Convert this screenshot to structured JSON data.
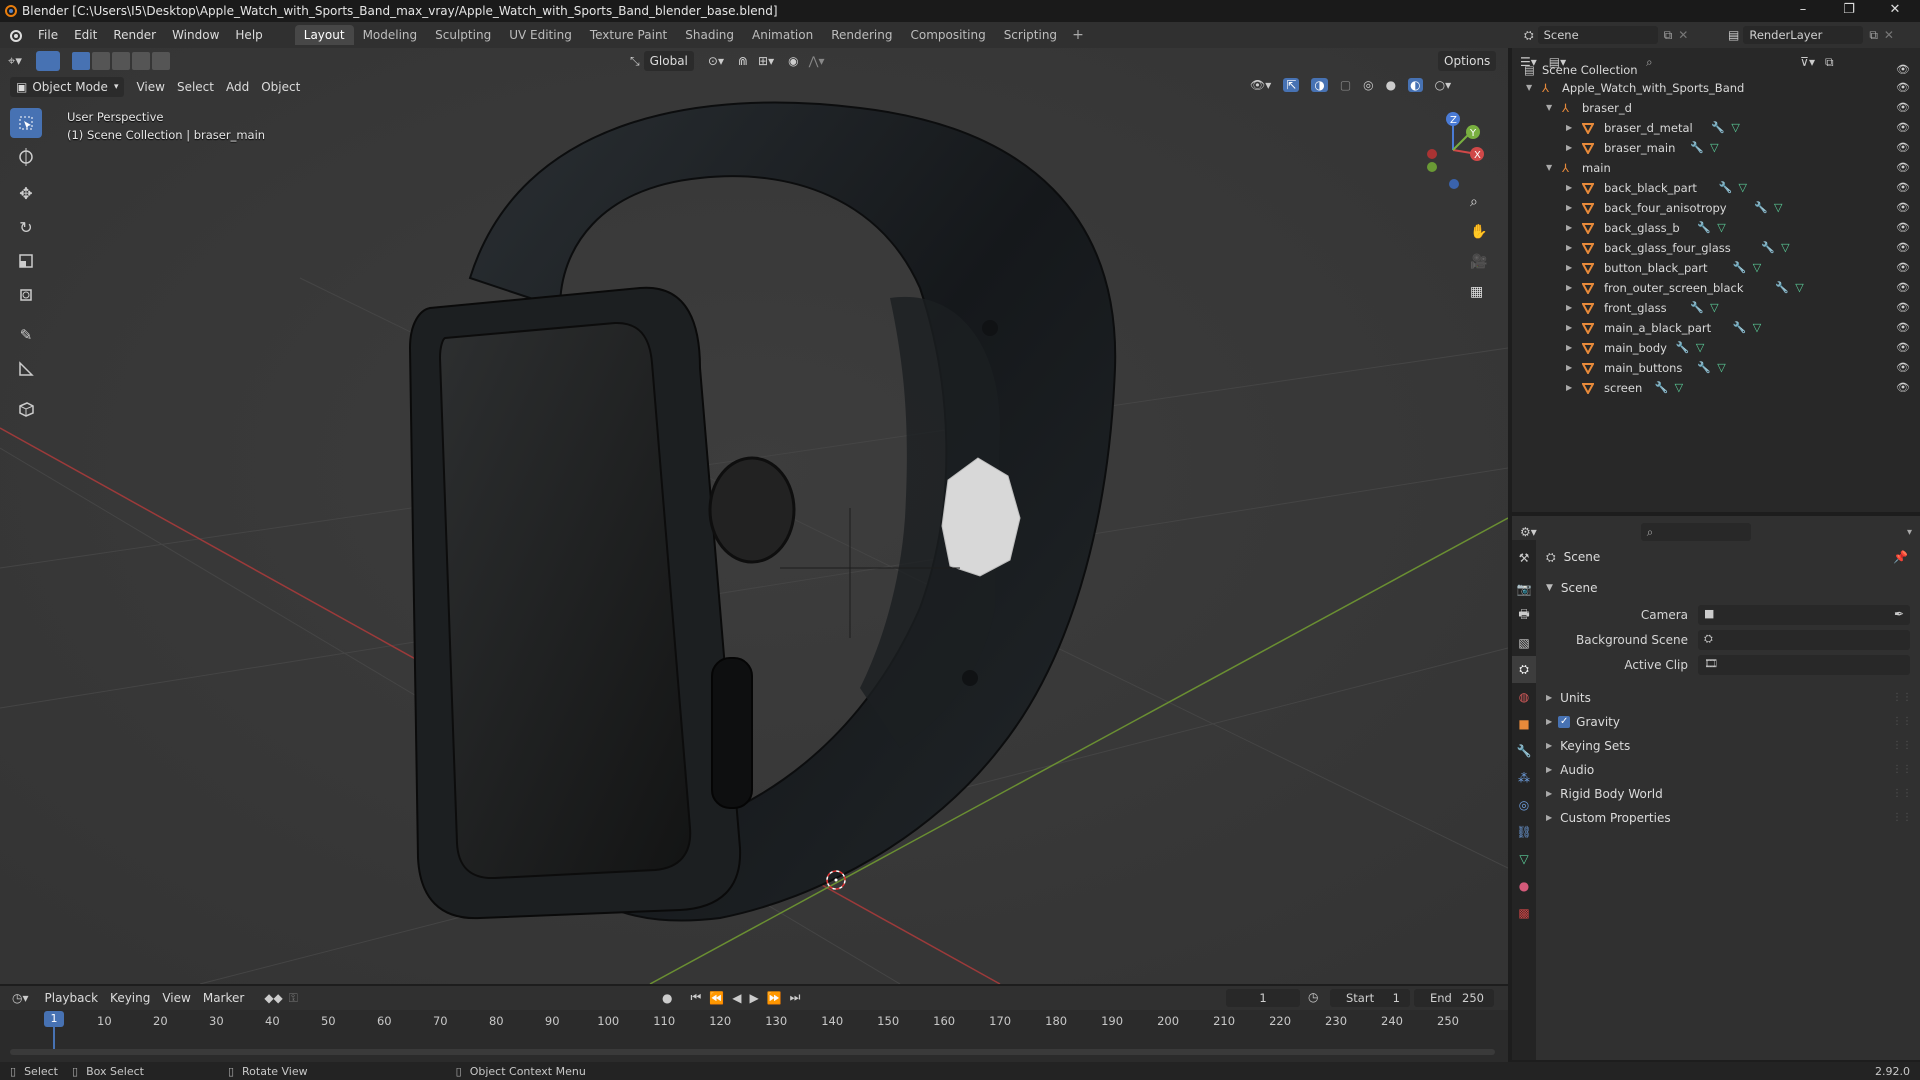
{
  "window": {
    "title": "Blender [C:\\Users\\I5\\Desktop\\Apple_Watch_with_Sports_Band_max_vray/Apple_Watch_with_Sports_Band_blender_base.blend]"
  },
  "menu": [
    "File",
    "Edit",
    "Render",
    "Window",
    "Help"
  ],
  "workspaces": [
    "Layout",
    "Modeling",
    "Sculpting",
    "UV Editing",
    "Texture Paint",
    "Shading",
    "Animation",
    "Rendering",
    "Compositing",
    "Scripting"
  ],
  "active_workspace": "Layout",
  "scene_field": "Scene",
  "view_layer_field": "RenderLayer",
  "viewport": {
    "mode": "Object Mode",
    "menus": [
      "View",
      "Select",
      "Add",
      "Object"
    ],
    "transform_orientation": "Global",
    "options_label": "Options",
    "overlay_line1": "User Perspective",
    "overlay_line2": "(1) Scene Collection | braser_main",
    "gizmo_axes": {
      "z": "Z",
      "y": "Y",
      "x": "X"
    }
  },
  "outliner": {
    "root": "Scene Collection",
    "collection": "Apple_Watch_with_Sports_Band",
    "groups": [
      {
        "name": "braser_d",
        "children": [
          "braser_d_metal",
          "braser_main"
        ]
      },
      {
        "name": "main",
        "children": [
          "back_black_part",
          "back_four_anisotropy",
          "back_glass_b",
          "back_glass_four_glass",
          "button_black_part",
          "fron_outer_screen_black",
          "front_glass",
          "main_a_black_part",
          "main_body",
          "main_buttons",
          "screen"
        ]
      }
    ]
  },
  "properties": {
    "header": "Scene",
    "panel_title": "Scene",
    "fields": [
      {
        "label": "Camera",
        "value": ""
      },
      {
        "label": "Background Scene",
        "value": ""
      },
      {
        "label": "Active Clip",
        "value": ""
      }
    ],
    "subpanels": [
      {
        "label": "Units",
        "checkbox": false
      },
      {
        "label": "Gravity",
        "checkbox": true
      },
      {
        "label": "Keying Sets",
        "checkbox": false
      },
      {
        "label": "Audio",
        "checkbox": false
      },
      {
        "label": "Rigid Body World",
        "checkbox": false
      },
      {
        "label": "Custom Properties",
        "checkbox": false
      }
    ]
  },
  "timeline": {
    "menus": [
      "Playback",
      "Keying",
      "View",
      "Marker"
    ],
    "current_frame": "1",
    "start_label": "Start",
    "start": "1",
    "end_label": "End",
    "end": "250",
    "ticks": [
      "1",
      "10",
      "20",
      "30",
      "40",
      "50",
      "60",
      "70",
      "80",
      "90",
      "100",
      "110",
      "120",
      "130",
      "140",
      "150",
      "160",
      "170",
      "180",
      "190",
      "200",
      "210",
      "220",
      "230",
      "240",
      "250"
    ]
  },
  "status": {
    "select": "Select",
    "box_select": "Box Select",
    "rotate_view": "Rotate View",
    "context_menu": "Object Context Menu",
    "version": "2.92.0"
  },
  "colors": {
    "accent": "#4772b3",
    "mesh_icon": "#e88a3a",
    "modifier_icon": "#6fa0e0",
    "data_icon": "#5ccf9a"
  }
}
